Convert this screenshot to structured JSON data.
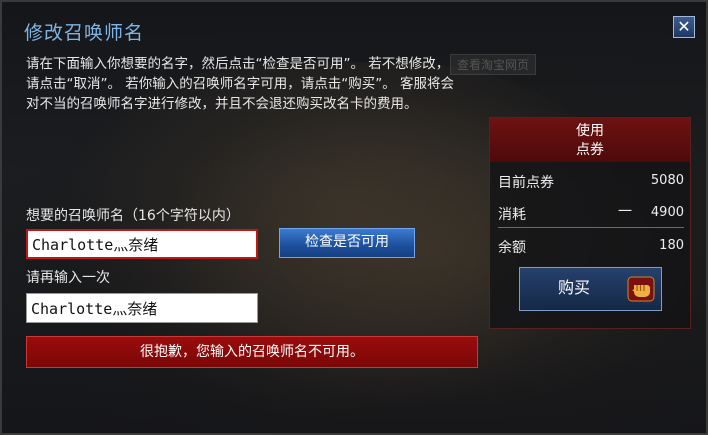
{
  "dialog": {
    "title": "修改召唤师名",
    "ghost_text": "查看淘宝网页",
    "description": "请在下面输入你想要的名字，然后点击“检查是否可用”。 若不想修改，请点击“取消”。 若你输入的召唤师名字可用，请点击“购买”。 客服将会对不当的召唤师名字进行修改，并且不会退还购买改名卡的费用。",
    "name_label": "想要的召唤师名（16个字符以内）",
    "name_value": "Charlotte灬奈绪",
    "check_button": "检查是否可用",
    "confirm_label": "请再输入一次",
    "confirm_value": "Charlotte灬奈绪",
    "error_message": "很抱歉，您输入的召唤师名不可用。"
  },
  "panel": {
    "header_line1": "使用",
    "header_line2": "点券",
    "balance_label": "目前点券",
    "balance_value": "5080",
    "cost_label": "消耗",
    "cost_sign": "一",
    "cost_value": "4900",
    "remaining_label": "余额",
    "remaining_value": "180",
    "buy_button": "购买"
  },
  "colors": {
    "title": "#7fb5e6",
    "error_bg": "#8a0a0a",
    "panel_header": "#5e0f0f",
    "check_button": "#2560b0"
  },
  "icons": [
    "close-icon",
    "fist-icon"
  ]
}
